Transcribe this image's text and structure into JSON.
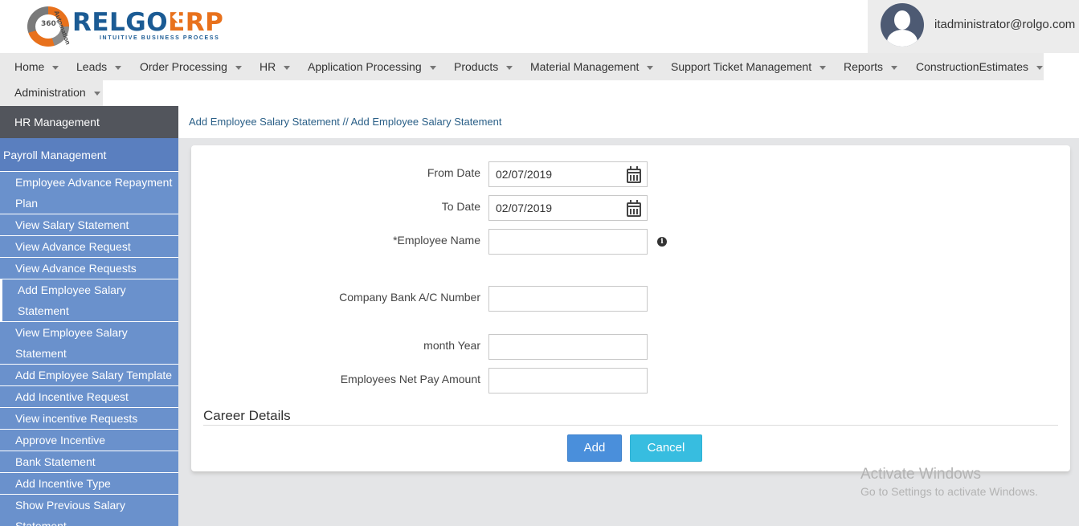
{
  "brand": {
    "name_part1": "RELGO",
    "name_part2": "ERP",
    "tagline": "INTUITIVE BUSINESS PROCESS",
    "badge": "360°",
    "badge_arc": "Automation"
  },
  "user": {
    "email": "itadministrator@rolgo.com"
  },
  "nav": {
    "items": [
      {
        "label": "Home"
      },
      {
        "label": "Leads"
      },
      {
        "label": "Order Processing"
      },
      {
        "label": "HR"
      },
      {
        "label": "Application Processing"
      },
      {
        "label": "Products"
      },
      {
        "label": "Material Management"
      },
      {
        "label": "Support Ticket Management"
      },
      {
        "label": "Reports"
      },
      {
        "label": "ConstructionEstimates"
      },
      {
        "label": "Administration"
      }
    ]
  },
  "sidebar": {
    "module": "HR Management",
    "section": "Payroll Management",
    "items": [
      {
        "label": "Employee Advance Repayment Plan"
      },
      {
        "label": "View Salary Statement"
      },
      {
        "label": "View Advance Request"
      },
      {
        "label": "View Advance Requests"
      },
      {
        "label": "Add Employee Salary Statement"
      },
      {
        "label": "View Employee Salary Statement"
      },
      {
        "label": "Add Employee Salary Template"
      },
      {
        "label": "Add Incentive Request"
      },
      {
        "label": "View incentive Requests"
      },
      {
        "label": "Approve Incentive"
      },
      {
        "label": "Bank Statement"
      },
      {
        "label": "Add Incentive Type"
      },
      {
        "label": "Show Previous Salary Statement"
      }
    ]
  },
  "breadcrumb": "Add Employee Salary Statement // Add Employee Salary Statement",
  "form": {
    "from_date": {
      "label": "From Date",
      "value": "02/07/2019"
    },
    "to_date": {
      "label": "To Date",
      "value": "02/07/2019"
    },
    "employee_name": {
      "label": "*Employee Name",
      "value": ""
    },
    "bank_account": {
      "label": "Company Bank A/C Number",
      "value": ""
    },
    "month_year": {
      "label": "month Year",
      "value": ""
    },
    "net_pay": {
      "label": "Employees Net Pay Amount",
      "value": ""
    },
    "section_title": "Career Details",
    "add_label": "Add",
    "cancel_label": "Cancel"
  },
  "watermark": {
    "line1": "Activate Windows",
    "line2": "Go to Settings to activate Windows."
  },
  "colors": {
    "sidebar": "#6a91cc",
    "sidebar_header": "#52555c",
    "add_button": "#4a8fdb",
    "cancel_button": "#37bde0",
    "brand_blue": "#1b5b94",
    "brand_orange": "#e8711c"
  }
}
